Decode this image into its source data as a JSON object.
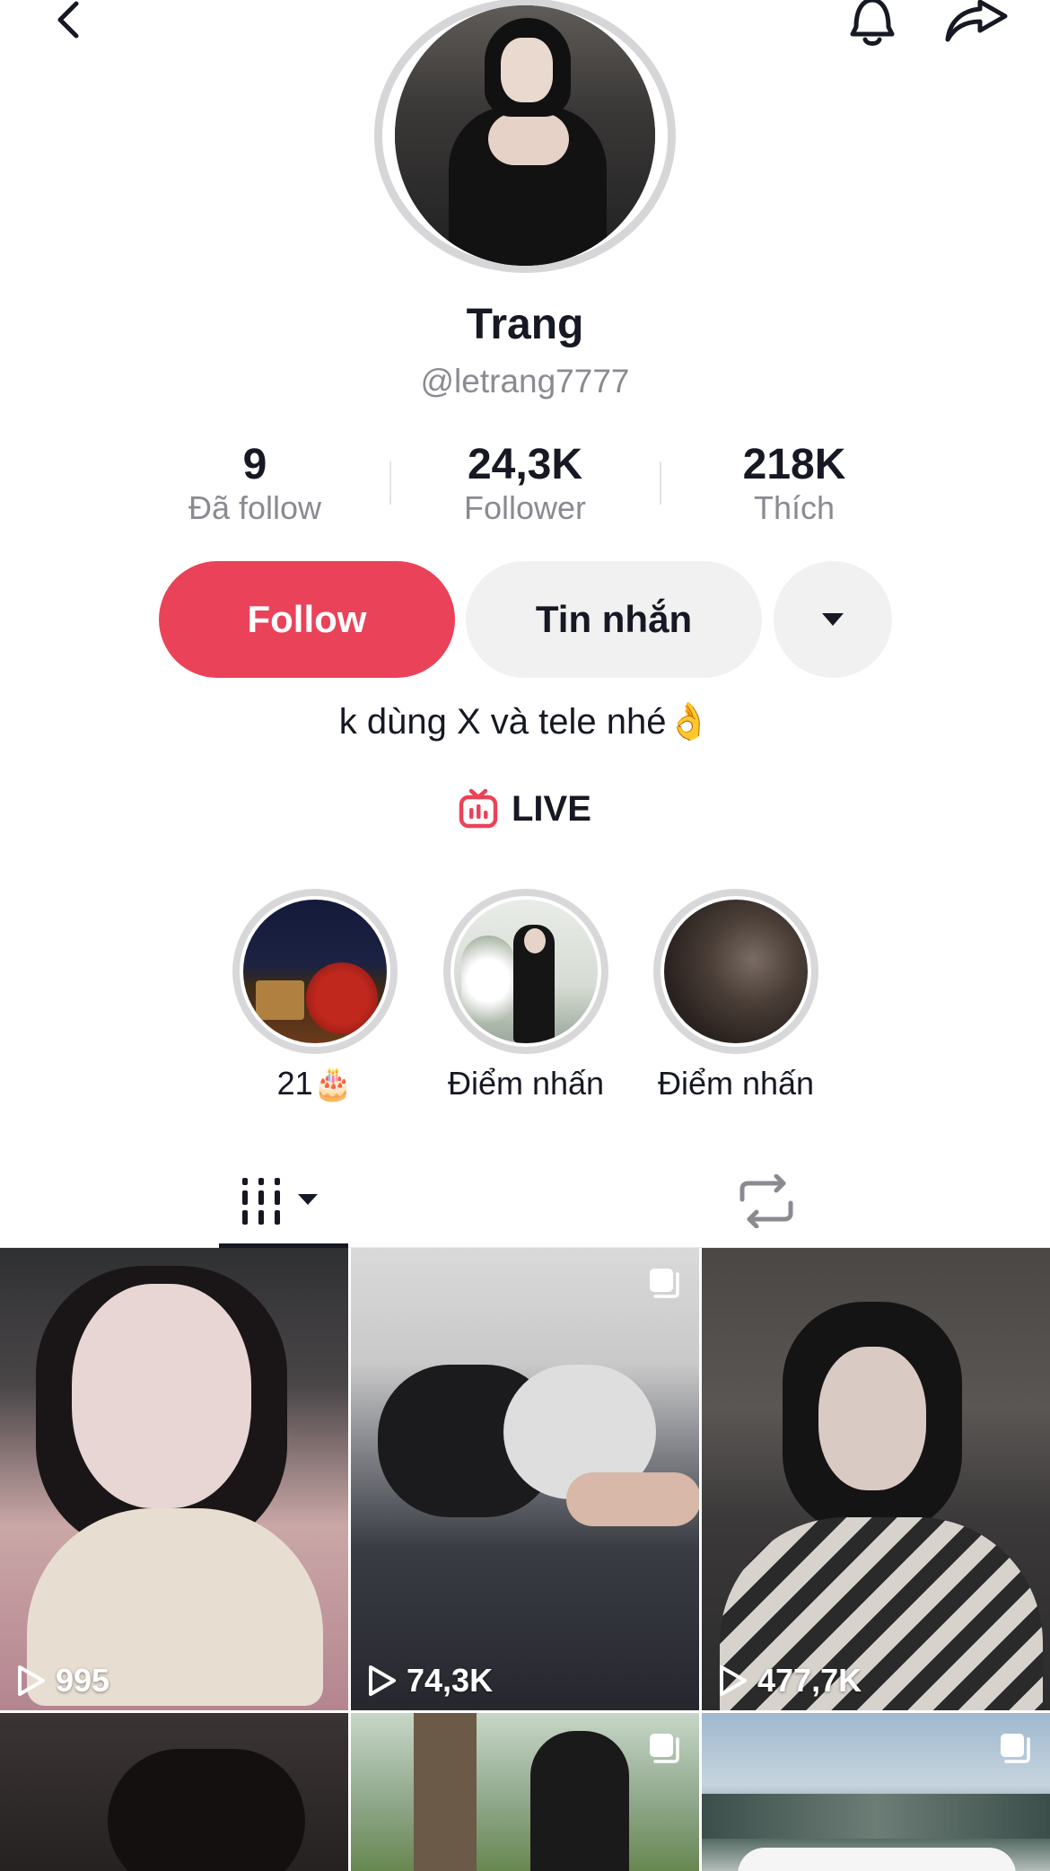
{
  "profile": {
    "name": "Trang",
    "handle": "@letrang7777",
    "bio": "k dùng X và tele nhé👌"
  },
  "stats": [
    {
      "value": "9",
      "label": "Đã follow"
    },
    {
      "value": "24,3K",
      "label": "Follower"
    },
    {
      "value": "218K",
      "label": "Thích"
    }
  ],
  "actions": {
    "follow_label": "Follow",
    "message_label": "Tin nhắn"
  },
  "live": {
    "label": "LIVE"
  },
  "highlights": [
    {
      "label": "21🎂"
    },
    {
      "label": "Điểm nhấn"
    },
    {
      "label": "Điểm nhấn"
    }
  ],
  "videos": [
    {
      "views": "995"
    },
    {
      "views": "74,3K"
    },
    {
      "views": "477,7K"
    }
  ],
  "colors": {
    "accent": "#ea4359",
    "text": "#161823",
    "secondary_text": "#8a8b91",
    "button_gray": "#f1f1f2"
  },
  "icons": {
    "back": "chevron-left-icon",
    "bell": "bell-icon",
    "share": "share-arrow-icon",
    "more": "caret-down-icon",
    "live": "live-tv-icon",
    "videos_tab": "video-grid-icon",
    "repost_tab": "repost-icon",
    "views": "play-icon",
    "multi": "multi-image-icon"
  }
}
